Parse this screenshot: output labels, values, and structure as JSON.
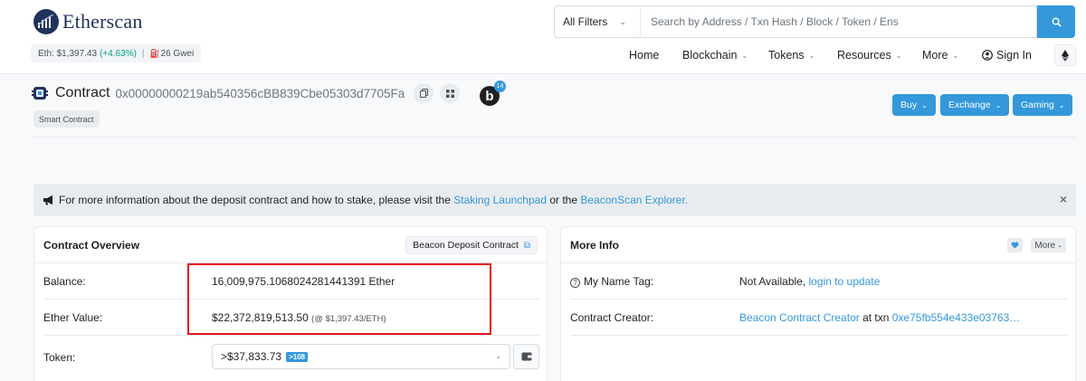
{
  "header": {
    "logo_text": "Etherscan",
    "eth_price_label": "Eth: $1,397.43",
    "eth_change": "(+4.63%)",
    "separator": "|",
    "gas": "26 Gwei",
    "search": {
      "filter_label": "All Filters",
      "placeholder": "Search by Address / Txn Hash / Block / Token / Ens"
    },
    "nav": {
      "home": "Home",
      "blockchain": "Blockchain",
      "tokens": "Tokens",
      "resources": "Resources",
      "more": "More",
      "sign_in": "Sign In"
    }
  },
  "title": {
    "label": "Contract",
    "address": "0x00000000219ab540356cBB839Cbe05303d7705Fa",
    "blockscan_letter": "b",
    "blockscan_count": "14",
    "badge": "Smart Contract",
    "buttons": {
      "buy": "Buy",
      "exchange": "Exchange",
      "gaming": "Gaming"
    }
  },
  "alert": {
    "text_before": "For more information about the deposit contract and how to stake, please visit the",
    "link1": "Staking Launchpad",
    "text_mid": "or the",
    "link2": "BeaconScan Explorer.",
    "close": "×"
  },
  "overview": {
    "title": "Contract Overview",
    "tag_button": "Beacon Deposit Contract",
    "balance_label": "Balance:",
    "balance_value": "16,009,975.1068024281441391 Ether",
    "ether_value_label": "Ether Value:",
    "ether_value": "$22,372,819,513.50",
    "ether_rate": "(@ $1,397.43/ETH)",
    "token_label": "Token:",
    "token_value": ">$37,833.73",
    "token_count": ">108"
  },
  "more_info": {
    "title": "More Info",
    "more_button": "More",
    "name_tag_label": "My Name Tag:",
    "name_tag_value": "Not Available,",
    "name_tag_link": "login to update",
    "creator_label": "Contract Creator:",
    "creator_link": "Beacon Contract Creator",
    "creator_at": "at txn",
    "creator_txn": "0xe75fb554e433e03763…"
  },
  "colors": {
    "brand": "#21325b",
    "accent": "#3498db",
    "positive": "#00a186",
    "highlight": "#e4141e"
  }
}
